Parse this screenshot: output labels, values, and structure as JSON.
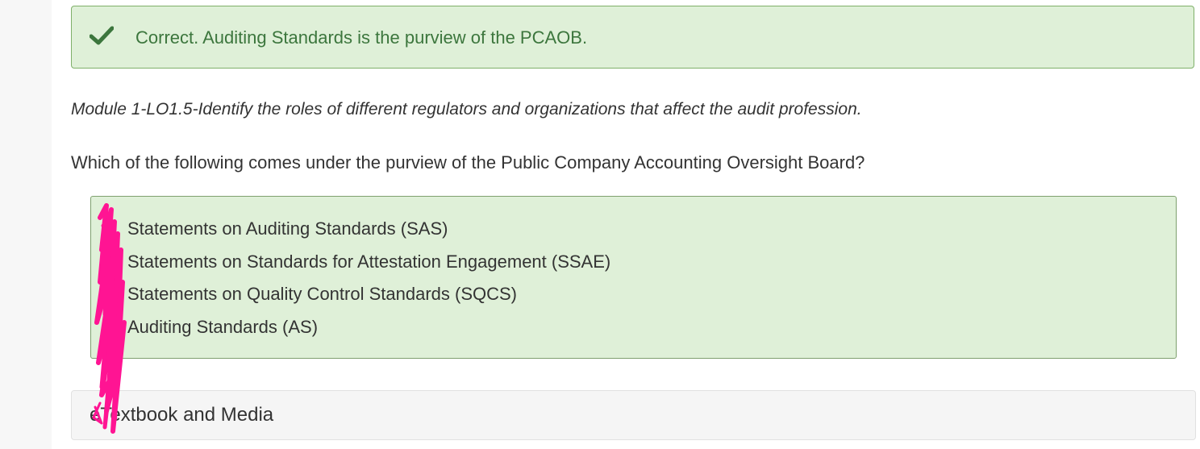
{
  "feedback": {
    "status": "correct",
    "icon": "checkmark-icon",
    "message": "Correct. Auditing Standards is the purview of the PCAOB.",
    "color": "#3c763d",
    "background": "#dff0d8"
  },
  "objective": "Module 1-LO1.5-Identify the roles of different regulators and organizations that affect the audit profession.",
  "question": "Which of the following comes under the purview of the Public Company Accounting Oversight Board?",
  "answers": [
    "Statements on Auditing Standards (SAS)",
    "Statements on Standards for Attestation Engagement (SSAE)",
    "Statements on Quality Control Standards (SQCS)",
    "Auditing Standards (AS)"
  ],
  "textbook": {
    "label": "eTextbook and Media"
  },
  "annotation_color": "#ff1493"
}
